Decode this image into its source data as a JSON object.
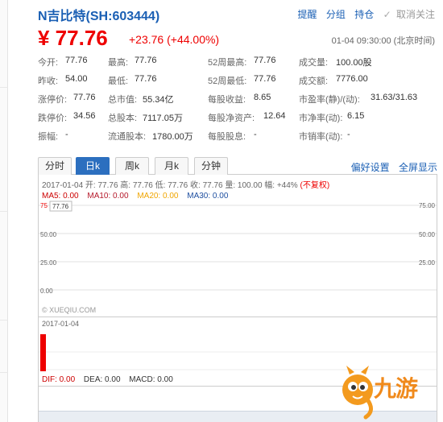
{
  "header": {
    "stock_name": "N吉比特(SH:603444)",
    "actions": {
      "remind": "提醒",
      "group": "分组",
      "holding": "持仓",
      "unfollow": "取消关注"
    }
  },
  "price": {
    "current": "¥ 77.76",
    "change": "+23.76",
    "change_pct": "(+44.00%)",
    "time": "01-04 09:30:00 (北京时间)"
  },
  "quote": {
    "rows": [
      [
        {
          "label": "今开:",
          "value": "77.76"
        },
        {
          "label": "最高:",
          "value": "77.76"
        },
        {
          "label": "52周最高:",
          "value": "77.76"
        },
        {
          "label": "成交量:",
          "value": "100.00股"
        }
      ],
      [
        {
          "label": "昨收:",
          "value": "54.00"
        },
        {
          "label": "最低:",
          "value": "77.76"
        },
        {
          "label": "52周最低:",
          "value": "77.76"
        },
        {
          "label": "成交额:",
          "value": "7776.00"
        }
      ],
      [
        {
          "label": "涨停价:",
          "value": "77.76"
        },
        {
          "label": "总市值:",
          "value": "55.34亿"
        },
        {
          "label": "每股收益:",
          "value": "8.65"
        },
        {
          "label": "市盈率(静)/(动):",
          "value": "31.63/31.63"
        }
      ],
      [
        {
          "label": "跌停价:",
          "value": "34.56"
        },
        {
          "label": "总股本:",
          "value": "7117.05万"
        },
        {
          "label": "每股净资产:",
          "value": "12.64"
        },
        {
          "label": "市净率(动):",
          "value": "6.15"
        }
      ],
      [
        {
          "label": "振幅:",
          "value": "-"
        },
        {
          "label": "流通股本:",
          "value": "1780.00万"
        },
        {
          "label": "每股股息:",
          "value": "-"
        },
        {
          "label": "市销率(动):",
          "value": "-"
        }
      ]
    ]
  },
  "tabs": {
    "items": [
      "分时",
      "日k",
      "周k",
      "月k",
      "分钟"
    ],
    "active_index": 1,
    "links": {
      "preferences": "偏好设置",
      "fullscreen": "全屏显示"
    }
  },
  "chart": {
    "info_line": "2017-01-04 开: 77.76 高: 77.76 低: 77.76 收: 77.76 量: 100.00 幅: +44%",
    "info_adjust": "(不复权)",
    "ma": [
      {
        "label": "MA5: 0.00",
        "color": "#cc0000"
      },
      {
        "label": "MA10: 0.00",
        "color": "#b5182a"
      },
      {
        "label": "MA20: 0.00",
        "color": "#f0a500"
      },
      {
        "label": "MA30: 0.00",
        "color": "#1e4fa0"
      }
    ],
    "price_tooltip": "77.76",
    "y_labels_left": [
      "0.00",
      "25.00",
      "50.00",
      "75"
    ],
    "y_labels_right": [
      "25.00",
      "50.00",
      "75.00"
    ],
    "watermark": "© XUEQIU.COM",
    "date": "2017-01-04",
    "macd": [
      {
        "label": "DIF: 0.00",
        "color": "#cc0000"
      },
      {
        "label": "DEA: 0.00",
        "color": "#333333"
      },
      {
        "label": "MACD: 0.00",
        "color": "#333333"
      }
    ]
  },
  "logo": {
    "text": "九游"
  }
}
